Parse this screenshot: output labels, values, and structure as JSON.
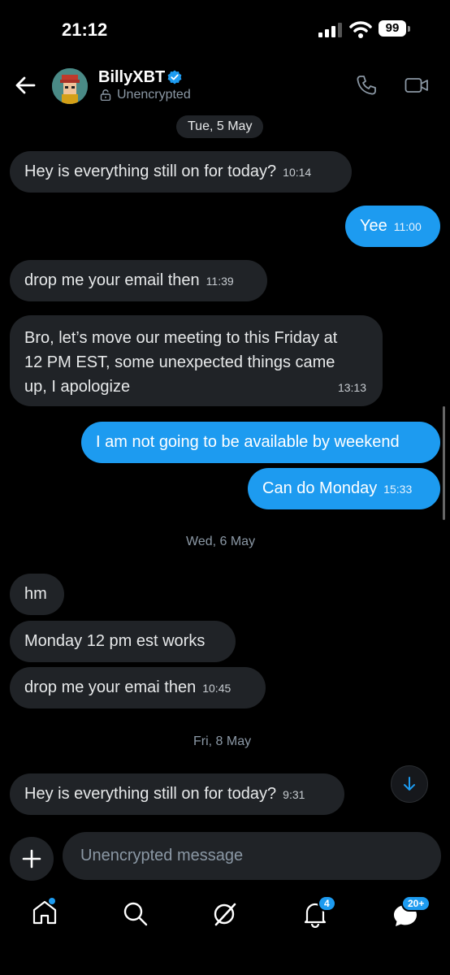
{
  "status_bar": {
    "time": "21:12",
    "battery": "99"
  },
  "header": {
    "name": "BillyXBT",
    "subtitle": "Unencrypted",
    "icons": {
      "back": "back-arrow-icon",
      "verified": "verified-badge-icon",
      "lock": "lock-icon",
      "call": "phone-icon",
      "video": "video-icon"
    }
  },
  "messages": {
    "date1": "Tue, 5 May",
    "m1": {
      "text": "Hey is everything still on for today?",
      "time": "10:14"
    },
    "m2": {
      "text": "Yee",
      "time": "11:00"
    },
    "m3": {
      "text": "drop me your email then",
      "time": "11:39"
    },
    "m4": {
      "line1": "Bro, let’s move our meeting to this Friday at",
      "line2": "12 PM EST, some unexpected things came",
      "line3": "up, I apologize",
      "time": "13:13"
    },
    "m5": {
      "text": "I am not going to be available by weekend"
    },
    "m6": {
      "text": "Can do Monday",
      "time": "15:33"
    },
    "date2": "Wed, 6 May",
    "m7": {
      "text": "hm"
    },
    "m8": {
      "text": "Monday 12 pm est works"
    },
    "m9": {
      "text": "drop me your emai then",
      "time": "10:45"
    },
    "date3": "Fri, 8 May",
    "m10": {
      "text": "Hey is everything still on for today?",
      "time": "9:31"
    }
  },
  "composer": {
    "placeholder": "Unencrypted message"
  },
  "nav": {
    "notifications_badge": "4",
    "messages_badge": "20+"
  },
  "colors": {
    "accent": "#1d9bf0",
    "bubble_received": "#202327",
    "background": "#000000"
  }
}
